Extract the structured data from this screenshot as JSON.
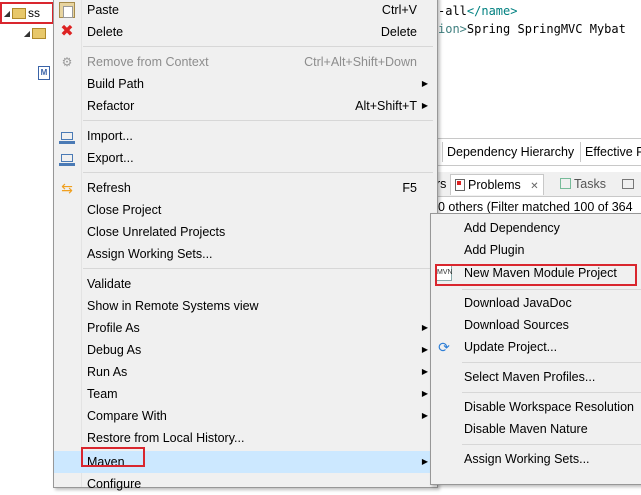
{
  "project_tree": {
    "project_label": "ss"
  },
  "editor": {
    "line1_prefix": "-all",
    "line1_close_tag": "</name>",
    "line2_prefix": "ion>",
    "line2_text": "Spring SpringMVC Mybat"
  },
  "pom_tabs": [
    "Dependency Hierarchy",
    "Effective P"
  ],
  "view_tabs": {
    "partial_left": "rs",
    "problems": "Problems",
    "problems_close": "✕",
    "tasks": "Tasks"
  },
  "problems_status": "0 others (Filter matched 100 of 364",
  "context_menu": {
    "items": [
      {
        "label": "Paste",
        "accel": "Ctrl+V",
        "icon": "paste-icon"
      },
      {
        "label": "Delete",
        "accel": "Delete",
        "icon": "delete-icon"
      },
      {
        "label": "Remove from Context",
        "accel": "Ctrl+Alt+Shift+Down",
        "icon": "remove-context-icon",
        "disabled": true
      },
      {
        "label": "Build Path"
      },
      {
        "label": "Refactor",
        "accel": "Alt+Shift+T"
      },
      {
        "label": "Import...",
        "icon": "import-icon"
      },
      {
        "label": "Export...",
        "icon": "export-icon"
      },
      {
        "label": "Refresh",
        "accel": "F5",
        "icon": "refresh-icon"
      },
      {
        "label": "Close Project"
      },
      {
        "label": "Close Unrelated Projects"
      },
      {
        "label": "Assign Working Sets..."
      },
      {
        "label": "Validate"
      },
      {
        "label": "Show in Remote Systems view"
      },
      {
        "label": "Profile As"
      },
      {
        "label": "Debug As"
      },
      {
        "label": "Run As"
      },
      {
        "label": "Team"
      },
      {
        "label": "Compare With"
      },
      {
        "label": "Restore from Local History..."
      },
      {
        "label": "Maven"
      },
      {
        "label": "Configure"
      }
    ]
  },
  "maven_submenu": {
    "items": [
      {
        "label": "Add Dependency"
      },
      {
        "label": "Add Plugin"
      },
      {
        "label": "New Maven Module Project",
        "icon": "maven-module-icon"
      },
      {
        "label": "Download JavaDoc"
      },
      {
        "label": "Download Sources"
      },
      {
        "label": "Update Project...",
        "icon": "update-project-icon"
      },
      {
        "label": "Select Maven Profiles..."
      },
      {
        "label": "Disable Workspace Resolution"
      },
      {
        "label": "Disable Maven Nature"
      },
      {
        "label": "Assign Working Sets..."
      }
    ]
  },
  "colors": {
    "highlight_red": "#d9262e",
    "menu_bg": "#f0f0f0",
    "hover_blue": "#cce8ff"
  }
}
